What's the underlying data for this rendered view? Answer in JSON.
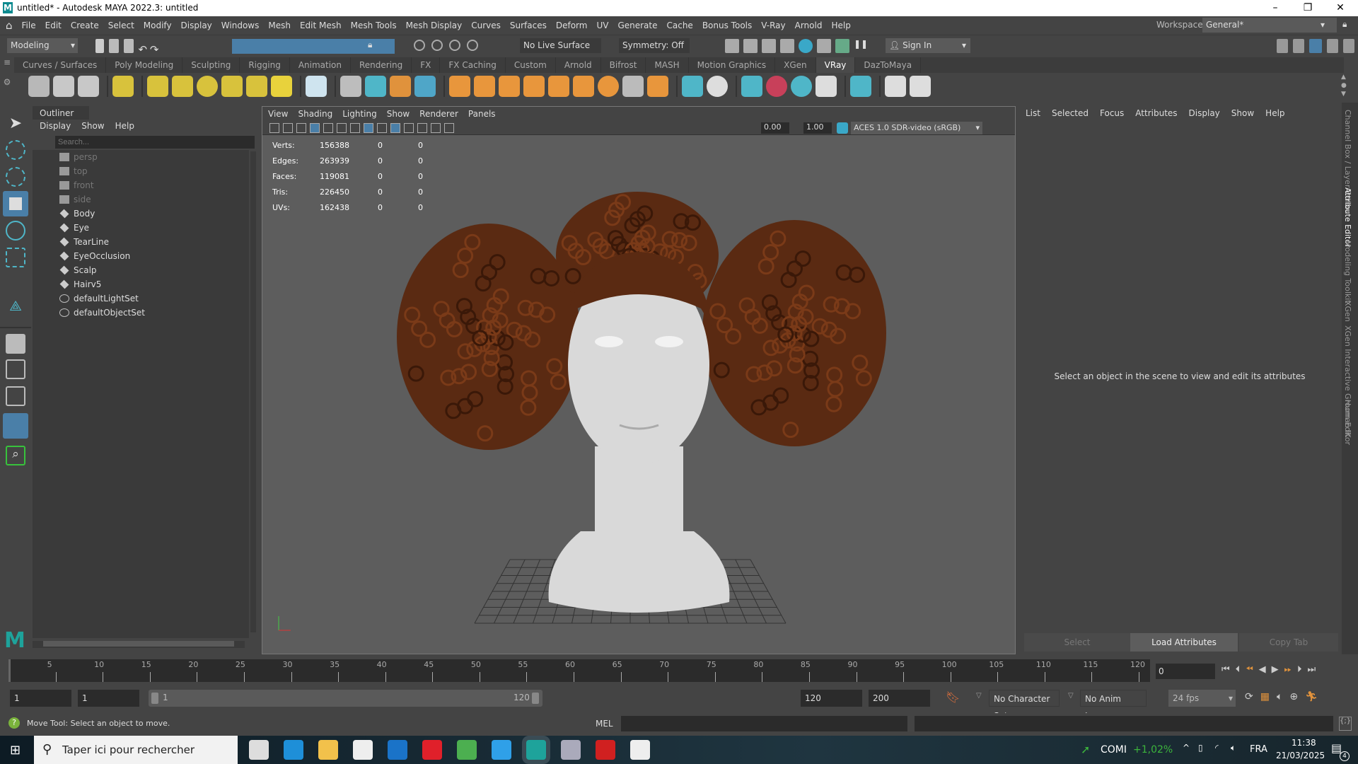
{
  "window": {
    "title": "untitled* - Autodesk MAYA 2022.3: untitled",
    "logo": "M"
  },
  "menubar": [
    "File",
    "Edit",
    "Create",
    "Select",
    "Modify",
    "Display",
    "Windows",
    "Mesh",
    "Edit Mesh",
    "Mesh Tools",
    "Mesh Display",
    "Curves",
    "Surfaces",
    "Deform",
    "UV",
    "Generate",
    "Cache",
    "Bonus Tools",
    "V-Ray",
    "Arnold",
    "Help"
  ],
  "workspace": {
    "label": "Workspace:",
    "value": "General*"
  },
  "statusline": {
    "mode": "Modeling",
    "live_surface": "No Live Surface",
    "symmetry": "Symmetry: Off",
    "sign_in": "Sign In"
  },
  "shelf_tabs": [
    "Curves / Surfaces",
    "Poly Modeling",
    "Sculpting",
    "Rigging",
    "Animation",
    "Rendering",
    "FX",
    "FX Caching",
    "Custom",
    "Arnold",
    "Bifrost",
    "MASH",
    "Motion Graphics",
    "XGen",
    "VRay",
    "DazToMaya"
  ],
  "active_shelf": "VRay",
  "shelf_icons": [
    {
      "name": "vray-frame-buffer-icon",
      "color": "#b8b8b8"
    },
    {
      "name": "vray-render-icon",
      "color": "#c8c8c8"
    },
    {
      "name": "vray-ipr-icon",
      "color": "#c8c8c8"
    },
    "sep",
    {
      "name": "light-lister-icon",
      "color": "#d8c23c"
    },
    "sep",
    {
      "name": "dome-light-icon",
      "color": "#d8c23c"
    },
    {
      "name": "spot-light-icon",
      "color": "#d8c23c"
    },
    {
      "name": "sphere-light-icon",
      "color": "#d8c23c"
    },
    {
      "name": "mesh-light-icon",
      "color": "#d8c23c"
    },
    {
      "name": "ies-light-icon",
      "color": "#d8c23c"
    },
    {
      "name": "sun-light-icon",
      "color": "#e8d23c"
    },
    "sep",
    {
      "name": "plane-icon",
      "color": "#cfe4ef"
    },
    "sep",
    {
      "name": "proxy-icon",
      "color": "#bdbdbd"
    },
    {
      "name": "export-proxy-icon",
      "color": "#4fb6c8"
    },
    {
      "name": "scene-icon",
      "color": "#e0923c"
    },
    {
      "name": "volume-icon",
      "color": "#4fa6c8"
    },
    "sep",
    {
      "name": "fur-icon",
      "color": "#e8963c"
    },
    {
      "name": "displacement-icon",
      "color": "#e8963c"
    },
    {
      "name": "grass-icon",
      "color": "#e8963c"
    },
    {
      "name": "material-icon",
      "color": "#e8963c"
    },
    {
      "name": "weave-icon",
      "color": "#e8963c"
    },
    {
      "name": "toon-icon",
      "color": "#e8963c"
    },
    {
      "name": "sphere-material-icon",
      "color": "#e8963c"
    },
    {
      "name": "object-properties-icon",
      "color": "#bbb"
    },
    {
      "name": "settings-gear-icon",
      "color": "#e8963c"
    },
    "sep",
    {
      "name": "cone-shape-icon",
      "color": "#4fb6c8"
    },
    {
      "name": "sphere-clip-icon",
      "color": "#ddd"
    },
    "sep",
    {
      "name": "file-shader-icon",
      "color": "#4fb6c8"
    },
    {
      "name": "color-ball-icon",
      "color": "#c8405a"
    },
    {
      "name": "multi-sphere-icon",
      "color": "#4fb6c8"
    },
    {
      "name": "palette-icon",
      "color": "#ddd"
    },
    "sep",
    {
      "name": "region-icon",
      "color": "#4fb6c8"
    },
    "sep",
    {
      "name": "plug-icon",
      "color": "#ddd"
    },
    {
      "name": "vray-logo-icon",
      "color": "#ddd"
    }
  ],
  "outliner": {
    "title": "Outliner",
    "menu": [
      "Display",
      "Show",
      "Help"
    ],
    "search_placeholder": "Search...",
    "items": [
      {
        "label": "persp",
        "type": "camera"
      },
      {
        "label": "top",
        "type": "camera"
      },
      {
        "label": "front",
        "type": "camera"
      },
      {
        "label": "side",
        "type": "camera"
      },
      {
        "label": "Body",
        "type": "mesh"
      },
      {
        "label": "Eye",
        "type": "mesh"
      },
      {
        "label": "TearLine",
        "type": "mesh"
      },
      {
        "label": "EyeOcclusion",
        "type": "mesh"
      },
      {
        "label": "Scalp",
        "type": "mesh"
      },
      {
        "label": "Hairv5",
        "type": "mesh"
      },
      {
        "label": "defaultLightSet",
        "type": "set"
      },
      {
        "label": "defaultObjectSet",
        "type": "set"
      }
    ]
  },
  "viewport": {
    "menu": [
      "View",
      "Shading",
      "Lighting",
      "Show",
      "Renderer",
      "Panels"
    ],
    "exposure": "0.00",
    "gamma": "1.00",
    "color_space": "ACES 1.0 SDR-video (sRGB)",
    "hud": [
      {
        "label": "Verts:",
        "total": "156388",
        "a": "0",
        "b": "0"
      },
      {
        "label": "Edges:",
        "total": "263939",
        "a": "0",
        "b": "0"
      },
      {
        "label": "Faces:",
        "total": "119081",
        "a": "0",
        "b": "0"
      },
      {
        "label": "Tris:",
        "total": "226450",
        "a": "0",
        "b": "0"
      },
      {
        "label": "UVs:",
        "total": "162438",
        "a": "0",
        "b": "0"
      }
    ],
    "colors": {
      "hair": "#5a2a12",
      "skin": "#d9d9d9",
      "bg": "#5d5d5d"
    }
  },
  "attribute_editor": {
    "menu": [
      "List",
      "Selected",
      "Focus",
      "Attributes",
      "Display",
      "Show",
      "Help"
    ],
    "message": "Select an object in the scene to view and edit its attributes",
    "buttons": {
      "select": "Select",
      "load": "Load Attributes",
      "copy": "Copy Tab"
    }
  },
  "side_tabs": [
    "Channel Box / Layer Editor",
    "Attribute Editor",
    "Modeling Toolkit",
    "XGen",
    "XGen Interactive Groom Editor",
    "Human IK"
  ],
  "timeline": {
    "ticks": [
      5,
      10,
      15,
      20,
      25,
      30,
      35,
      40,
      45,
      50,
      55,
      60,
      65,
      70,
      75,
      80,
      85,
      90,
      95,
      100,
      105,
      110,
      115,
      120
    ],
    "current_frame": "0",
    "start": 1,
    "end": 120
  },
  "range": {
    "start": "1",
    "playback_start": "1",
    "range_min": "1",
    "range_max": "120",
    "playback_end": "120",
    "end": "200",
    "character_set": "No Character Set",
    "anim_layer": "No Anim Layer",
    "fps": "24 fps"
  },
  "commandline": {
    "help": "Move Tool: Select an object to move.",
    "lang": "MEL"
  },
  "taskbar": {
    "search": "Taper ici pour rechercher",
    "stock": "COMI",
    "stock_change": "+1,02%",
    "lang": "FRA",
    "time": "11:38",
    "date": "21/03/2025",
    "notifications": "4",
    "apps": [
      {
        "name": "task-view-icon",
        "color": "#ddd"
      },
      {
        "name": "edge-icon",
        "color": "#1e8fd8"
      },
      {
        "name": "file-explorer-icon",
        "color": "#f2c14b"
      },
      {
        "name": "store-icon",
        "color": "#eee"
      },
      {
        "name": "outlook-icon",
        "color": "#1a73c8"
      },
      {
        "name": "opera-icon",
        "color": "#e0202a"
      },
      {
        "name": "chrome-icon",
        "color": "#4caf50"
      },
      {
        "name": "photoshop-icon",
        "color": "#2fa0e8"
      },
      {
        "name": "maya-icon",
        "color": "#1ea39b"
      },
      {
        "name": "monitor-icon",
        "color": "#aab"
      },
      {
        "name": "t-app-icon",
        "color": "#d02020"
      },
      {
        "name": "3d-viewer-icon",
        "color": "#eee"
      }
    ]
  }
}
